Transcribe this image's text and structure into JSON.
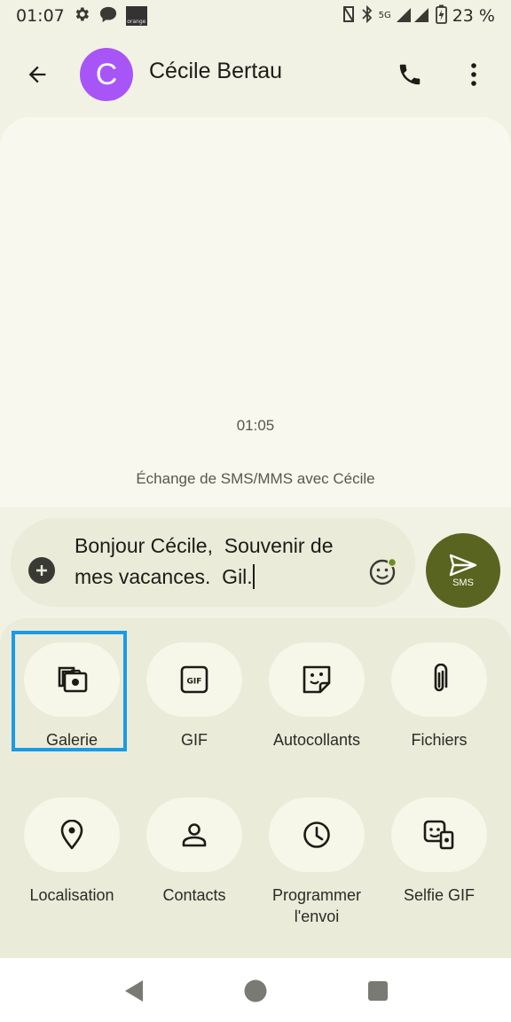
{
  "status_bar": {
    "time": "01:07",
    "operator_logo_text": "orange",
    "battery": "23 %",
    "network": "5G",
    "icons": [
      "settings-icon",
      "chat-bubble-icon",
      "operator-logo",
      "nfc-icon",
      "bluetooth-icon",
      "signal-icon",
      "battery-icon"
    ]
  },
  "header": {
    "contact_initial": "C",
    "contact_name": "Cécile Bertau",
    "avatar_color": "#a855f7"
  },
  "conversation": {
    "timestamp": "01:05",
    "info": "Échange de SMS/MMS avec Cécile"
  },
  "compose": {
    "text": "Bonjour Cécile,  Souvenir de mes vacances.  Gil.",
    "send_label": "SMS",
    "send_color": "#58641f"
  },
  "attachments": [
    {
      "label": "Galerie",
      "icon": "gallery-icon"
    },
    {
      "label": "GIF",
      "icon": "gif-icon"
    },
    {
      "label": "Autocollants",
      "icon": "sticker-icon"
    },
    {
      "label": "Fichiers",
      "icon": "paperclip-icon"
    },
    {
      "label": "Localisation",
      "icon": "location-icon"
    },
    {
      "label": "Contacts",
      "icon": "contact-icon"
    },
    {
      "label": "Programmer l'envoi",
      "icon": "schedule-icon"
    },
    {
      "label": "Selfie GIF",
      "icon": "selfie-gif-icon"
    }
  ],
  "highlight_color": "#1a9be6"
}
